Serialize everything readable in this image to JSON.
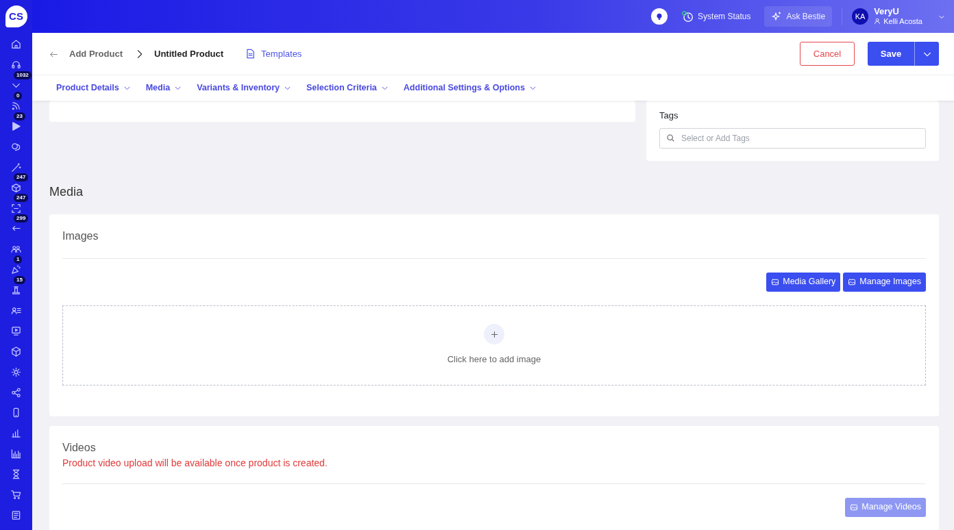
{
  "topbar": {
    "system_status": "System Status",
    "ask": "Ask Bestie",
    "avatar": "KA",
    "org": "VeryU",
    "user": "Kelli Acosta"
  },
  "sidebar": {
    "logo": "CS",
    "items": [
      {
        "kind": "home"
      },
      {
        "kind": "headset"
      },
      {
        "kind": "chevron",
        "badge": "1032"
      },
      {
        "kind": "feed",
        "badge": "0"
      },
      {
        "kind": "play",
        "badge": "23"
      },
      {
        "kind": "chat"
      },
      {
        "kind": "wand"
      },
      {
        "kind": "box",
        "badge": "247"
      },
      {
        "kind": "scan",
        "badge": "247"
      },
      {
        "kind": "return",
        "badge": "299"
      },
      {
        "kind": "people"
      },
      {
        "kind": "party",
        "badge": "1"
      },
      {
        "kind": "stamp",
        "badge": "15"
      },
      {
        "kind": "userlist"
      },
      {
        "kind": "monitor"
      },
      {
        "kind": "cube"
      },
      {
        "kind": "gear"
      },
      {
        "kind": "share"
      },
      {
        "kind": "phone"
      },
      {
        "kind": "bars"
      },
      {
        "kind": "chart"
      },
      {
        "kind": "hourglass"
      },
      {
        "kind": "cart"
      },
      {
        "kind": "doc"
      }
    ]
  },
  "header": {
    "breadcrumb": [
      "Add Product",
      "Untitled Product"
    ],
    "templates": "Templates",
    "cancel": "Cancel",
    "save": "Save"
  },
  "tabs": [
    {
      "label": "Product Details"
    },
    {
      "label": "Media"
    },
    {
      "label": "Variants & Inventory"
    },
    {
      "label": "Selection Criteria"
    },
    {
      "label": "Additional Settings & Options"
    }
  ],
  "tags": {
    "label": "Tags",
    "placeholder": "Select or Add Tags"
  },
  "media": {
    "heading": "Media",
    "images": {
      "title": "Images",
      "buttons": [
        "Media Gallery",
        "Manage Images"
      ],
      "dropzone": "Click here to add image"
    },
    "videos": {
      "title": "Videos",
      "notice": "Product video upload will be available once product is created.",
      "button": "Manage Videos",
      "disabled": true
    }
  }
}
